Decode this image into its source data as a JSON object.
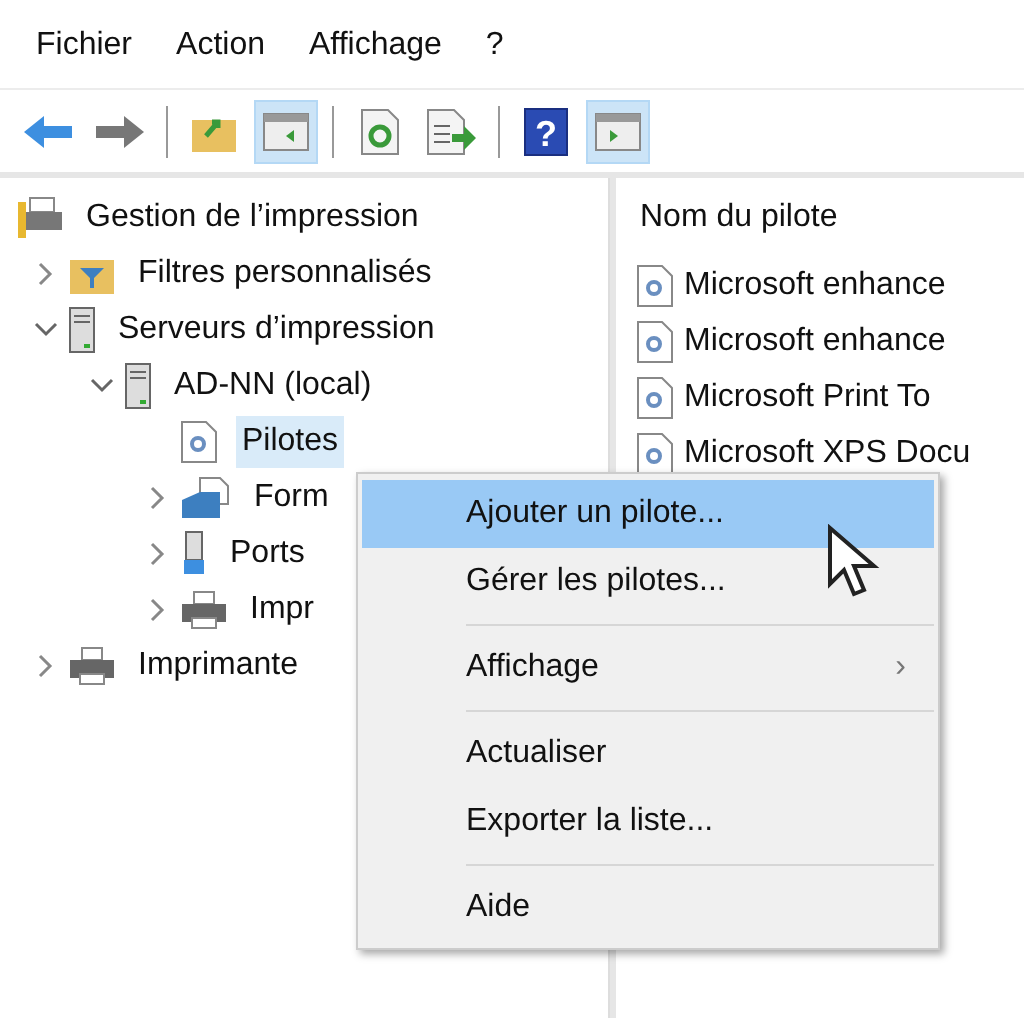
{
  "menu_bar": [
    "Fichier",
    "Action",
    "Affichage",
    "?"
  ],
  "toolbar": [
    {
      "kind": "back",
      "pressed": false
    },
    {
      "kind": "forward",
      "pressed": false
    },
    {
      "kind": "sep"
    },
    {
      "kind": "up",
      "pressed": false
    },
    {
      "kind": "tree",
      "pressed": true
    },
    {
      "kind": "sep"
    },
    {
      "kind": "refresh",
      "pressed": false
    },
    {
      "kind": "export",
      "pressed": false
    },
    {
      "kind": "sep"
    },
    {
      "kind": "help",
      "label": "?",
      "pressed": false
    },
    {
      "kind": "actionpane",
      "pressed": true
    }
  ],
  "tree": [
    {
      "label": "Gestion de l’impression",
      "kind": "root",
      "selected": false,
      "children": [
        {
          "label": "Filtres personnalisés",
          "kind": "filter",
          "expanded": false,
          "selected": false
        },
        {
          "label": "Serveurs d’impression",
          "kind": "server",
          "expanded": true,
          "selected": false,
          "children": [
            {
              "label": "AD-NN (local)",
              "kind": "server",
              "expanded": true,
              "selected": false,
              "children": [
                {
                  "label": "Pilotes",
                  "kind": "drivers",
                  "selected": true
                },
                {
                  "label": "Form",
                  "kind": "forms",
                  "expanded": false,
                  "selected": false
                },
                {
                  "label": "Ports",
                  "kind": "ports",
                  "expanded": false,
                  "selected": false
                },
                {
                  "label": "Impr",
                  "kind": "printer",
                  "expanded": false,
                  "selected": false
                }
              ]
            }
          ]
        },
        {
          "label": "Imprimante",
          "kind": "printer",
          "expanded": false,
          "selected": false
        }
      ]
    }
  ],
  "list": {
    "column_header": "Nom du pilote",
    "rows": [
      "Microsoft enhance",
      "Microsoft enhance",
      "Microsoft Print To",
      "Microsoft XPS Docu"
    ]
  },
  "context_menu": [
    {
      "kind": "item",
      "label": "Ajouter un pilote...",
      "selected": true
    },
    {
      "kind": "item",
      "label": "Gérer les pilotes...",
      "selected": false
    },
    {
      "kind": "sep"
    },
    {
      "kind": "submenu",
      "label": "Affichage",
      "arrow": "›",
      "selected": false
    },
    {
      "kind": "sep"
    },
    {
      "kind": "item",
      "label": "Actualiser",
      "selected": false
    },
    {
      "kind": "item",
      "label": "Exporter la liste...",
      "selected": false
    },
    {
      "kind": "sep"
    },
    {
      "kind": "item",
      "label": "Aide",
      "selected": false
    }
  ]
}
